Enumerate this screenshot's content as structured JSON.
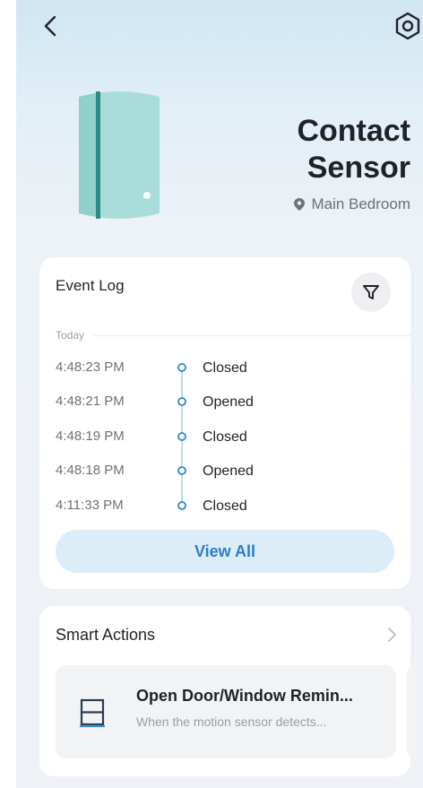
{
  "header": {
    "back_icon": "chevron-left-icon",
    "settings_icon": "hex-gear-icon"
  },
  "device": {
    "name": "Contact Sensor",
    "name_line1": "Contact",
    "name_line2": "Sensor",
    "location": "Main Bedroom",
    "location_icon": "map-pin-icon",
    "accent_color": "#2d8a88",
    "body_color": "#a8ddd9"
  },
  "event_log": {
    "title": "Event Log",
    "filter_icon": "filter-icon",
    "day_label": "Today",
    "events": [
      {
        "time": "4:48:23 PM",
        "state": "Closed"
      },
      {
        "time": "4:48:21 PM",
        "state": "Opened"
      },
      {
        "time": "4:48:19 PM",
        "state": "Closed"
      },
      {
        "time": "4:48:18 PM",
        "state": "Opened"
      },
      {
        "time": "4:11:33 PM",
        "state": "Closed"
      }
    ],
    "view_all_label": "View All"
  },
  "smart_actions": {
    "title": "Smart Actions",
    "chevron_icon": "chevron-right-icon",
    "items": [
      {
        "icon": "window-icon",
        "title": "Open Door/Window Remin...",
        "description": "When the motion sensor detects..."
      }
    ]
  },
  "colors": {
    "primary": "#2a7fc4",
    "primary_light": "#dcedf8",
    "timeline_dot": "#3d8fd1"
  }
}
